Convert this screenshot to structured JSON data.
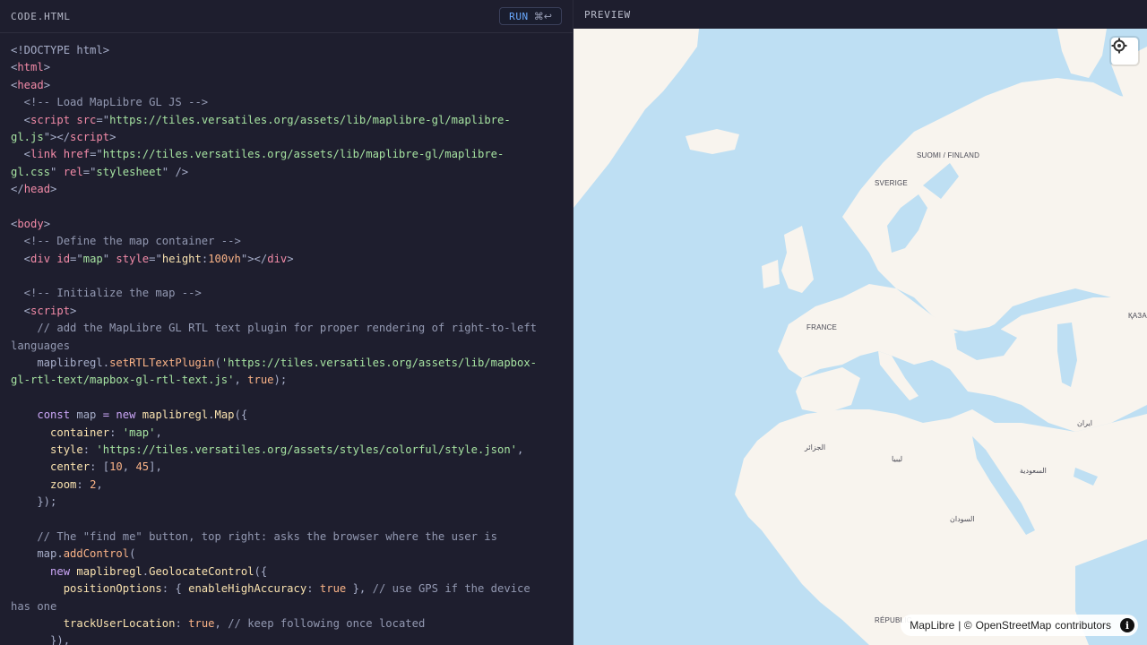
{
  "editor": {
    "title": "CODE.HTML",
    "run_label": "RUN",
    "run_shortcut": "⌘↩"
  },
  "preview": {
    "title": "PREVIEW"
  },
  "code_lines": [
    [
      {
        "t": "<!DOCTYPE html>",
        "c": "c-dim"
      }
    ],
    [
      {
        "t": "<",
        "c": "c-dim"
      },
      {
        "t": "html",
        "c": "c-tag"
      },
      {
        "t": ">",
        "c": "c-dim"
      }
    ],
    [
      {
        "t": "<",
        "c": "c-dim"
      },
      {
        "t": "head",
        "c": "c-tag"
      },
      {
        "t": ">",
        "c": "c-dim"
      }
    ],
    [
      {
        "t": "  <!-- Load MapLibre GL JS -->",
        "c": "c-com"
      }
    ],
    [
      {
        "t": "  <",
        "c": "c-dim"
      },
      {
        "t": "script",
        "c": "c-tag"
      },
      {
        "t": " src",
        "c": "c-attr"
      },
      {
        "t": "=\"",
        "c": "c-dim"
      },
      {
        "t": "https://tiles.versatiles.org/assets/lib/maplibre-gl/maplibre-",
        "c": "c-str"
      }
    ],
    [
      {
        "t": "gl.js",
        "c": "c-str"
      },
      {
        "t": "\"></",
        "c": "c-dim"
      },
      {
        "t": "script",
        "c": "c-tag"
      },
      {
        "t": ">",
        "c": "c-dim"
      }
    ],
    [
      {
        "t": "  <",
        "c": "c-dim"
      },
      {
        "t": "link",
        "c": "c-tag"
      },
      {
        "t": " href",
        "c": "c-attr"
      },
      {
        "t": "=\"",
        "c": "c-dim"
      },
      {
        "t": "https://tiles.versatiles.org/assets/lib/maplibre-gl/maplibre-",
        "c": "c-str"
      }
    ],
    [
      {
        "t": "gl.css",
        "c": "c-str"
      },
      {
        "t": "\"",
        "c": "c-dim"
      },
      {
        "t": " rel",
        "c": "c-attr"
      },
      {
        "t": "=\"",
        "c": "c-dim"
      },
      {
        "t": "stylesheet",
        "c": "c-str"
      },
      {
        "t": "\" />",
        "c": "c-dim"
      }
    ],
    [
      {
        "t": "</",
        "c": "c-dim"
      },
      {
        "t": "head",
        "c": "c-tag"
      },
      {
        "t": ">",
        "c": "c-dim"
      }
    ],
    [
      {
        "t": "",
        "c": "c-dim"
      }
    ],
    [
      {
        "t": "<",
        "c": "c-dim"
      },
      {
        "t": "body",
        "c": "c-tag"
      },
      {
        "t": ">",
        "c": "c-dim"
      }
    ],
    [
      {
        "t": "  <!-- Define the map container -->",
        "c": "c-com"
      }
    ],
    [
      {
        "t": "  <",
        "c": "c-dim"
      },
      {
        "t": "div",
        "c": "c-tag"
      },
      {
        "t": " id",
        "c": "c-attr"
      },
      {
        "t": "=\"",
        "c": "c-dim"
      },
      {
        "t": "map",
        "c": "c-str"
      },
      {
        "t": "\"",
        "c": "c-dim"
      },
      {
        "t": " style",
        "c": "c-attr"
      },
      {
        "t": "=\"",
        "c": "c-dim"
      },
      {
        "t": "height",
        "c": "c-prop"
      },
      {
        "t": ":",
        "c": "c-dim"
      },
      {
        "t": "100vh",
        "c": "c-num"
      },
      {
        "t": "\"></",
        "c": "c-dim"
      },
      {
        "t": "div",
        "c": "c-tag"
      },
      {
        "t": ">",
        "c": "c-dim"
      }
    ],
    [
      {
        "t": "",
        "c": "c-dim"
      }
    ],
    [
      {
        "t": "  <!-- Initialize the map -->",
        "c": "c-com"
      }
    ],
    [
      {
        "t": "  <",
        "c": "c-dim"
      },
      {
        "t": "script",
        "c": "c-tag"
      },
      {
        "t": ">",
        "c": "c-dim"
      }
    ],
    [
      {
        "t": "    // add the MapLibre GL RTL text plugin for proper rendering of right-to-left",
        "c": "c-com"
      }
    ],
    [
      {
        "t": "languages",
        "c": "c-com"
      }
    ],
    [
      {
        "t": "    maplibregl.",
        "c": "c-dim"
      },
      {
        "t": "setRTLTextPlugin",
        "c": "c-meth"
      },
      {
        "t": "(",
        "c": "c-dim"
      },
      {
        "t": "'https://tiles.versatiles.org/assets/lib/mapbox-",
        "c": "c-str"
      }
    ],
    [
      {
        "t": "gl-rtl-text/mapbox-gl-rtl-text.js'",
        "c": "c-str"
      },
      {
        "t": ", ",
        "c": "c-dim"
      },
      {
        "t": "true",
        "c": "c-ok"
      },
      {
        "t": ");",
        "c": "c-dim"
      }
    ],
    [
      {
        "t": "",
        "c": "c-dim"
      }
    ],
    [
      {
        "t": "    ",
        "c": "c-dim"
      },
      {
        "t": "const",
        "c": "c-kw"
      },
      {
        "t": " map ",
        "c": "c-dim"
      },
      {
        "t": "=",
        "c": "c-kw"
      },
      {
        "t": " ",
        "c": "c-dim"
      },
      {
        "t": "new",
        "c": "c-kw"
      },
      {
        "t": " ",
        "c": "c-dim"
      },
      {
        "t": "maplibregl",
        "c": "c-fn"
      },
      {
        "t": ".",
        "c": "c-dim"
      },
      {
        "t": "Map",
        "c": "c-fn"
      },
      {
        "t": "({",
        "c": "c-dim"
      }
    ],
    [
      {
        "t": "      ",
        "c": "c-dim"
      },
      {
        "t": "container",
        "c": "c-prop"
      },
      {
        "t": ": ",
        "c": "c-dim"
      },
      {
        "t": "'map'",
        "c": "c-str"
      },
      {
        "t": ",",
        "c": "c-dim"
      }
    ],
    [
      {
        "t": "      ",
        "c": "c-dim"
      },
      {
        "t": "style",
        "c": "c-prop"
      },
      {
        "t": ": ",
        "c": "c-dim"
      },
      {
        "t": "'https://tiles.versatiles.org/assets/styles/colorful/style.json'",
        "c": "c-str"
      },
      {
        "t": ",",
        "c": "c-dim"
      }
    ],
    [
      {
        "t": "      ",
        "c": "c-dim"
      },
      {
        "t": "center",
        "c": "c-prop"
      },
      {
        "t": ": [",
        "c": "c-dim"
      },
      {
        "t": "10",
        "c": "c-num"
      },
      {
        "t": ", ",
        "c": "c-dim"
      },
      {
        "t": "45",
        "c": "c-num"
      },
      {
        "t": "],",
        "c": "c-dim"
      }
    ],
    [
      {
        "t": "      ",
        "c": "c-dim"
      },
      {
        "t": "zoom",
        "c": "c-prop"
      },
      {
        "t": ": ",
        "c": "c-dim"
      },
      {
        "t": "2",
        "c": "c-num"
      },
      {
        "t": ",",
        "c": "c-dim"
      }
    ],
    [
      {
        "t": "    });",
        "c": "c-dim"
      }
    ],
    [
      {
        "t": "",
        "c": "c-dim"
      }
    ],
    [
      {
        "t": "    // The \"find me\" button, top right: asks the browser where the user is",
        "c": "c-com"
      }
    ],
    [
      {
        "t": "    map.",
        "c": "c-dim"
      },
      {
        "t": "addControl",
        "c": "c-meth"
      },
      {
        "t": "(",
        "c": "c-dim"
      }
    ],
    [
      {
        "t": "      ",
        "c": "c-dim"
      },
      {
        "t": "new",
        "c": "c-kw"
      },
      {
        "t": " ",
        "c": "c-dim"
      },
      {
        "t": "maplibregl",
        "c": "c-fn"
      },
      {
        "t": ".",
        "c": "c-dim"
      },
      {
        "t": "GeolocateControl",
        "c": "c-fn"
      },
      {
        "t": "({",
        "c": "c-dim"
      }
    ],
    [
      {
        "t": "        ",
        "c": "c-dim"
      },
      {
        "t": "positionOptions",
        "c": "c-prop"
      },
      {
        "t": ": { ",
        "c": "c-dim"
      },
      {
        "t": "enableHighAccuracy",
        "c": "c-prop"
      },
      {
        "t": ": ",
        "c": "c-dim"
      },
      {
        "t": "true",
        "c": "c-ok"
      },
      {
        "t": " }, ",
        "c": "c-dim"
      },
      {
        "t": "// use GPS if the device",
        "c": "c-com"
      }
    ],
    [
      {
        "t": "has one",
        "c": "c-com"
      }
    ],
    [
      {
        "t": "        ",
        "c": "c-dim"
      },
      {
        "t": "trackUserLocation",
        "c": "c-prop"
      },
      {
        "t": ": ",
        "c": "c-dim"
      },
      {
        "t": "true",
        "c": "c-ok"
      },
      {
        "t": ", ",
        "c": "c-dim"
      },
      {
        "t": "// keep following once located",
        "c": "c-com"
      }
    ],
    [
      {
        "t": "      }),",
        "c": "c-dim"
      }
    ]
  ],
  "map": {
    "labels": [
      {
        "text": "SUOMI / FINLAND"
      },
      {
        "text": "SVERIGE"
      },
      {
        "text": "FRANCE"
      },
      {
        "text": "ҚАЗА"
      },
      {
        "text": "ایران"
      },
      {
        "text": "الجزائر"
      },
      {
        "text": "ليبيا"
      },
      {
        "text": "السعودية"
      },
      {
        "text": "السودان"
      },
      {
        "text": "RÉPUBLIC"
      }
    ],
    "attribution": {
      "maplibre": "MapLibre",
      "separator": " | © ",
      "osm": "OpenStreetMap",
      "contributors": " contributors"
    },
    "geolocate_icon": "crosshair-icon",
    "info_icon": "info-icon",
    "colors": {
      "water": "#bedff3",
      "land": "#f8f4ee"
    }
  }
}
